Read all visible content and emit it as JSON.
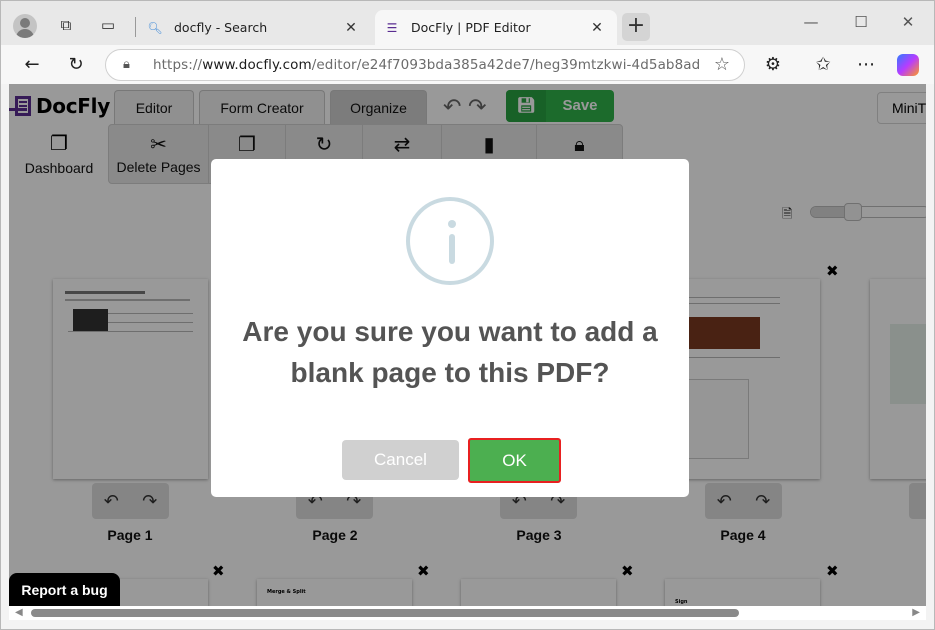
{
  "browser": {
    "tabs": [
      {
        "title": "docfly - Search",
        "icon": "search-icon",
        "active": false
      },
      {
        "title": "DocFly | PDF Editor",
        "icon": "docfly-icon",
        "active": true
      }
    ],
    "new_tab_label": "+",
    "url_prefix": "https://",
    "url_domain": "www.docfly.com",
    "url_path": "/editor/e24f7093bda385a42de7/heg39mtzkwi-4d5ab8ad"
  },
  "app": {
    "logo_text": "DocFly",
    "brand_color": "#5a2d91",
    "tabs": [
      {
        "label": "Editor",
        "active": false
      },
      {
        "label": "Form Creator",
        "active": false
      },
      {
        "label": "Organize",
        "active": true
      }
    ],
    "save_label": "Save",
    "minit_label": "MiniT",
    "dashboard_label": "Dashboard",
    "tools": [
      {
        "label": "Delete Pages",
        "icon": "scissors-icon"
      },
      {
        "label": "",
        "icon": "copy-pages-icon"
      },
      {
        "label": "",
        "icon": "rotate-icon"
      },
      {
        "label": "",
        "icon": "swap-icon"
      },
      {
        "label": "",
        "icon": "blank-page-icon"
      },
      {
        "label": "",
        "icon": "lock-icon"
      }
    ],
    "zoom_level": 0.35,
    "pages": [
      {
        "label": "Page 1"
      },
      {
        "label": "Page 2"
      },
      {
        "label": "Page 3"
      },
      {
        "label": "Page 4"
      }
    ],
    "second_row_page_titles": [
      "Merge & Split",
      "Sign"
    ],
    "report_bug_label": "Report a bug"
  },
  "dialog": {
    "title": "Are you sure you want to add a blank page to this PDF?",
    "cancel_label": "Cancel",
    "ok_label": "OK",
    "ok_color": "#4caf50",
    "highlight_color": "#e82020"
  }
}
